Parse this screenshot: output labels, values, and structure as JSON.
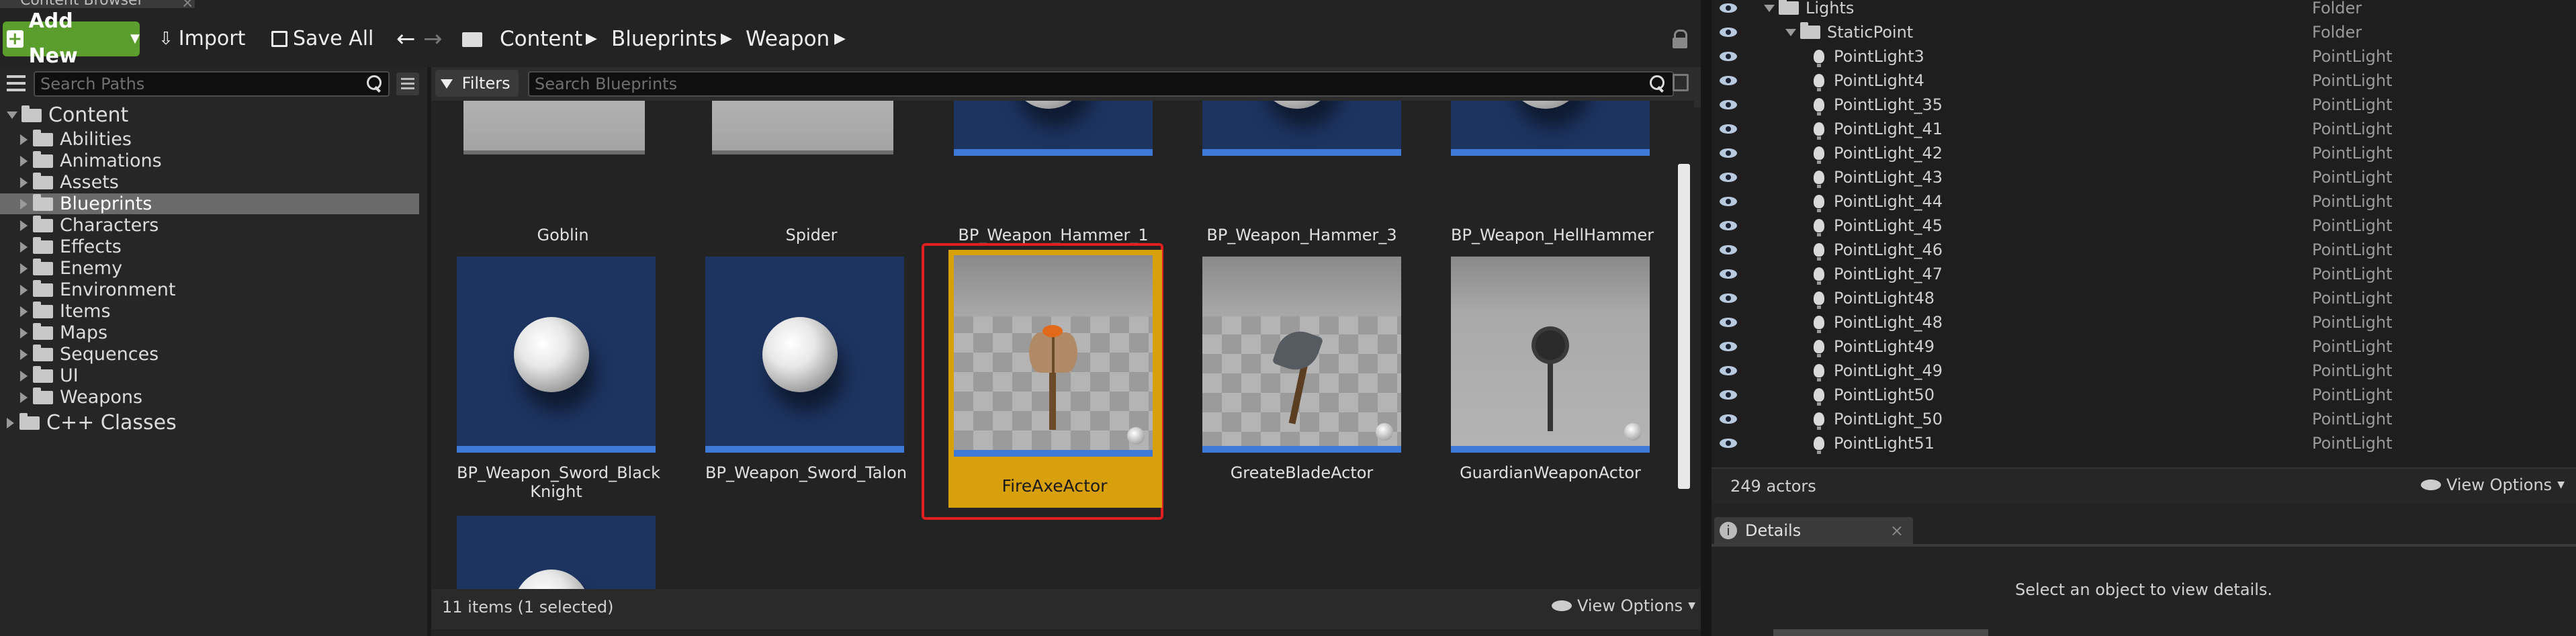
{
  "window": {
    "tab_title": "Content Browser"
  },
  "toolbar": {
    "add_new": "Add New",
    "import": "Import",
    "save_all": "Save All",
    "breadcrumb": [
      "Content",
      "Blueprints",
      "Weapon"
    ]
  },
  "sources": {
    "search_placeholder": "Search Paths",
    "root": "Content",
    "folders": [
      "Abilities",
      "Animations",
      "Assets",
      "Blueprints",
      "Characters",
      "Effects",
      "Enemy",
      "Environment",
      "Items",
      "Maps",
      "Sequences",
      "UI",
      "Weapons"
    ],
    "selected_folder": "Blueprints",
    "cpp": "C++ Classes"
  },
  "assets": {
    "filters_label": "Filters",
    "search_placeholder": "Search Blueprints",
    "row1": [
      "Goblin",
      "Spider",
      "BP_Weapon_Hammer_1",
      "BP_Weapon_Hammer_3",
      "BP_Weapon_HellHammer"
    ],
    "row2": [
      "BP_Weapon_Sword_Black Knight",
      "BP_Weapon_Sword_Talon",
      "FireAxeActor",
      "GreateBladeActor",
      "GuardianWeaponActor"
    ],
    "selected": "FireAxeActor",
    "status": "11 items (1 selected)",
    "view_options": "View Options",
    "colors": {
      "selection": "#d9a00d",
      "highlight_box": "#e02020",
      "thumb_blue": "#1d3461"
    }
  },
  "outliner": {
    "rows": [
      {
        "name": "Lights",
        "type": "Folder",
        "kind": "folder"
      },
      {
        "name": "StaticPoint",
        "type": "Folder",
        "kind": "folder"
      },
      {
        "name": "PointLight3",
        "type": "PointLight",
        "kind": "light"
      },
      {
        "name": "PointLight4",
        "type": "PointLight",
        "kind": "light"
      },
      {
        "name": "PointLight_35",
        "type": "PointLight",
        "kind": "light"
      },
      {
        "name": "PointLight_41",
        "type": "PointLight",
        "kind": "light"
      },
      {
        "name": "PointLight_42",
        "type": "PointLight",
        "kind": "light"
      },
      {
        "name": "PointLight_43",
        "type": "PointLight",
        "kind": "light"
      },
      {
        "name": "PointLight_44",
        "type": "PointLight",
        "kind": "light"
      },
      {
        "name": "PointLight_45",
        "type": "PointLight",
        "kind": "light"
      },
      {
        "name": "PointLight_46",
        "type": "PointLight",
        "kind": "light"
      },
      {
        "name": "PointLight_47",
        "type": "PointLight",
        "kind": "light"
      },
      {
        "name": "PointLight48",
        "type": "PointLight",
        "kind": "light"
      },
      {
        "name": "PointLight_48",
        "type": "PointLight",
        "kind": "light"
      },
      {
        "name": "PointLight49",
        "type": "PointLight",
        "kind": "light"
      },
      {
        "name": "PointLight_49",
        "type": "PointLight",
        "kind": "light"
      },
      {
        "name": "PointLight50",
        "type": "PointLight",
        "kind": "light"
      },
      {
        "name": "PointLight_50",
        "type": "PointLight",
        "kind": "light"
      },
      {
        "name": "PointLight51",
        "type": "PointLight",
        "kind": "light"
      }
    ],
    "count": "249 actors",
    "view_options": "View Options"
  },
  "details": {
    "tab": "Details",
    "empty_text": "Select an object to view details."
  }
}
